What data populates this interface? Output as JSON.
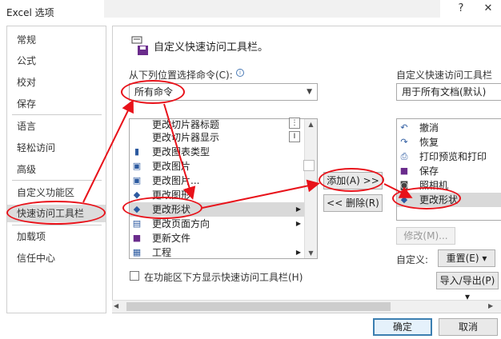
{
  "window": {
    "title": "Excel 选项"
  },
  "sidebar": {
    "items": [
      {
        "label": "常规"
      },
      {
        "label": "公式"
      },
      {
        "label": "校对"
      },
      {
        "label": "保存"
      },
      {
        "label": "语言"
      },
      {
        "label": "轻松访问"
      },
      {
        "label": "高级"
      },
      {
        "label": "自定义功能区"
      },
      {
        "label": "快速访问工具栏"
      },
      {
        "label": "加载项"
      },
      {
        "label": "信任中心"
      }
    ],
    "selected_index": 8
  },
  "header": {
    "title": "自定义快速访问工具栏。"
  },
  "left_panel": {
    "choose_label": "从下列位置选择命令(C):",
    "choose_value": "所有命令",
    "commands": [
      {
        "label": "更改切片器标题",
        "icon": "slicer-icon"
      },
      {
        "label": "更改切片器显示",
        "icon": "slicer-icon"
      },
      {
        "label": "更改图表类型",
        "icon": "chart-icon"
      },
      {
        "label": "更改图片",
        "icon": "picture-icon"
      },
      {
        "label": "更改图片...",
        "icon": "picture-icon"
      },
      {
        "label": "更改图形",
        "icon": "shape-icon"
      },
      {
        "label": "更改形状",
        "icon": "shape-icon"
      },
      {
        "label": "更改页面方向",
        "icon": "page-icon"
      },
      {
        "label": "更新文件",
        "icon": "update-icon"
      },
      {
        "label": "工程",
        "icon": "project-icon"
      }
    ]
  },
  "middle": {
    "add_label": "添加(A) >>",
    "remove_label": "<< 删除(R)"
  },
  "right_panel": {
    "customize_label": "自定义快速访问工具栏",
    "scope_value": "用于所有文档(默认)",
    "items": [
      {
        "label": "撤消",
        "icon": "undo-icon"
      },
      {
        "label": "恢复",
        "icon": "redo-icon"
      },
      {
        "label": "打印预览和打印",
        "icon": "print-preview-icon"
      },
      {
        "label": "保存",
        "icon": "save-icon"
      },
      {
        "label": "照相机",
        "icon": "camera-icon"
      },
      {
        "label": "更改形状",
        "icon": "shape-icon"
      }
    ],
    "modify_label": "修改(M)...",
    "customize_prefix": "自定义:",
    "reset_label": "重置(E) ▾",
    "import_export_label": "导入/导出(P) ▾"
  },
  "checkbox": {
    "label": "在功能区下方显示快速访问工具栏(H)"
  },
  "footer": {
    "ok_label": "确定",
    "cancel_label": "取消"
  },
  "colors": {
    "annotation": "#e8121a",
    "selected_bg": "#d9d9d9",
    "ok_border": "#3c7fb1"
  }
}
